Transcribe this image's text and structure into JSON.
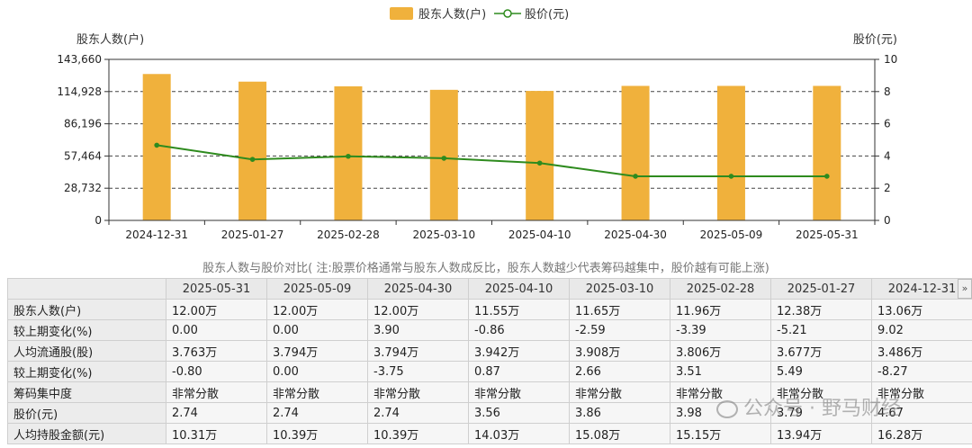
{
  "chart_data": {
    "type": "bar+line",
    "legend": {
      "position": "top-center",
      "bar_label": "股东人数(户)",
      "line_label": "股价(元)"
    },
    "categories": [
      "2024-12-31",
      "2025-01-27",
      "2025-02-28",
      "2025-03-10",
      "2025-04-10",
      "2025-04-30",
      "2025-05-09",
      "2025-05-31"
    ],
    "bar_series": {
      "name": "股东人数(户)",
      "values": [
        130600,
        123800,
        119600,
        116500,
        115500,
        120000,
        120000,
        120000
      ],
      "color": "#f0b13c"
    },
    "line_series": {
      "name": "股价(元)",
      "values": [
        4.67,
        3.79,
        3.98,
        3.86,
        3.56,
        2.74,
        2.74,
        2.74
      ],
      "color": "#2e8b1e"
    },
    "left_axis": {
      "label": "股东人数(户)",
      "ylim": [
        0,
        143660
      ],
      "ticks": [
        "0",
        "28,732",
        "57,464",
        "86,196",
        "114,928",
        "143,660"
      ]
    },
    "right_axis": {
      "label": "股价(元)",
      "ylim": [
        0,
        10
      ],
      "ticks": [
        "0",
        "2",
        "4",
        "6",
        "8",
        "10"
      ]
    },
    "grid": true
  },
  "caption": "股东人数与股价对比( 注:股票价格通常与股东人数成反比，股东人数越少代表筹码越集中，股价越有可能上涨)",
  "table": {
    "headers": [
      "2025-05-31",
      "2025-05-09",
      "2025-04-30",
      "2025-04-10",
      "2025-03-10",
      "2025-02-28",
      "2025-01-27",
      "2024-12-31"
    ],
    "rows": [
      {
        "label": "股东人数(户)",
        "cells": [
          {
            "text": "12.00万"
          },
          {
            "text": "12.00万"
          },
          {
            "text": "12.00万"
          },
          {
            "text": "11.55万"
          },
          {
            "text": "11.65万"
          },
          {
            "text": "11.96万"
          },
          {
            "text": "12.38万"
          },
          {
            "text": "13.06万"
          }
        ]
      },
      {
        "label": "较上期变化(%)",
        "cells": [
          {
            "text": "0.00"
          },
          {
            "text": "0.00"
          },
          {
            "text": "3.90",
            "sign": "pos"
          },
          {
            "text": "-0.86",
            "sign": "neg"
          },
          {
            "text": "-2.59",
            "sign": "neg"
          },
          {
            "text": "-3.39",
            "sign": "neg"
          },
          {
            "text": "-5.21",
            "sign": "neg"
          },
          {
            "text": "9.02",
            "sign": "pos"
          }
        ]
      },
      {
        "label": "人均流通股(股)",
        "cells": [
          {
            "text": "3.763万"
          },
          {
            "text": "3.794万"
          },
          {
            "text": "3.794万"
          },
          {
            "text": "3.942万"
          },
          {
            "text": "3.908万"
          },
          {
            "text": "3.806万"
          },
          {
            "text": "3.677万"
          },
          {
            "text": "3.486万"
          }
        ]
      },
      {
        "label": "较上期变化(%)",
        "cells": [
          {
            "text": "-0.80",
            "sign": "neg"
          },
          {
            "text": "0.00"
          },
          {
            "text": "-3.75",
            "sign": "neg"
          },
          {
            "text": "0.87",
            "sign": "pos"
          },
          {
            "text": "2.66",
            "sign": "pos"
          },
          {
            "text": "3.51",
            "sign": "pos"
          },
          {
            "text": "5.49",
            "sign": "pos"
          },
          {
            "text": "-8.27",
            "sign": "neg"
          }
        ]
      },
      {
        "label": "筹码集中度",
        "cells": [
          {
            "text": "非常分散"
          },
          {
            "text": "非常分散"
          },
          {
            "text": "非常分散"
          },
          {
            "text": "非常分散"
          },
          {
            "text": "非常分散"
          },
          {
            "text": "非常分散"
          },
          {
            "text": "非常分散"
          },
          {
            "text": "非常分散"
          }
        ]
      },
      {
        "label": "股价(元)",
        "cells": [
          {
            "text": "2.74"
          },
          {
            "text": "2.74"
          },
          {
            "text": "2.74"
          },
          {
            "text": "3.56"
          },
          {
            "text": "3.86"
          },
          {
            "text": "3.98"
          },
          {
            "text": "3.79"
          },
          {
            "text": "4.67"
          }
        ]
      },
      {
        "label": "人均持股金额(元)",
        "cells": [
          {
            "text": "10.31万"
          },
          {
            "text": "10.39万"
          },
          {
            "text": "10.39万"
          },
          {
            "text": "14.03万"
          },
          {
            "text": "15.08万"
          },
          {
            "text": "15.15万"
          },
          {
            "text": "13.94万"
          },
          {
            "text": "16.28万"
          }
        ]
      }
    ]
  },
  "scroll_button_symbol": "»",
  "watermark": "公众号 · 野马财经"
}
